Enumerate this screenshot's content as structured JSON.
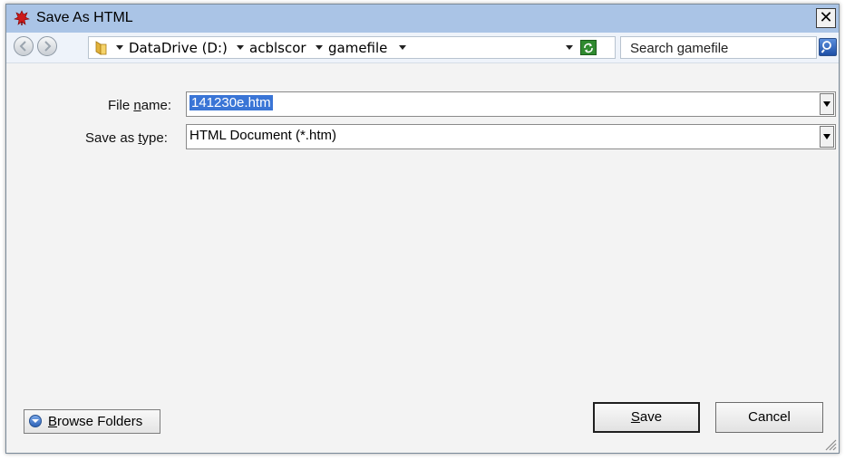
{
  "window": {
    "title": "Save As HTML",
    "close_glyph": "✕",
    "app_icon": "red-leaf-icon"
  },
  "toolbar": {
    "breadcrumbs": [
      "DataDrive (D:)",
      "acblscor",
      "gamefile"
    ],
    "search_placeholder": "Search gamefile"
  },
  "form": {
    "filename_label_pre": "File ",
    "filename_label_u": "n",
    "filename_label_post": "ame:",
    "filename_value": "141230e.htm",
    "type_label_pre": "Save as ",
    "type_label_u": "t",
    "type_label_post": "ype:",
    "type_value": "HTML Document (*.htm)"
  },
  "footer": {
    "browse_u": "B",
    "browse_rest": "rowse Folders",
    "save_u": "S",
    "save_rest": "ave",
    "cancel_label": "Cancel"
  },
  "colors": {
    "titlebar": "#aac4e6",
    "selection": "#3a75d6",
    "dialog_bg": "#f3f3f3"
  }
}
